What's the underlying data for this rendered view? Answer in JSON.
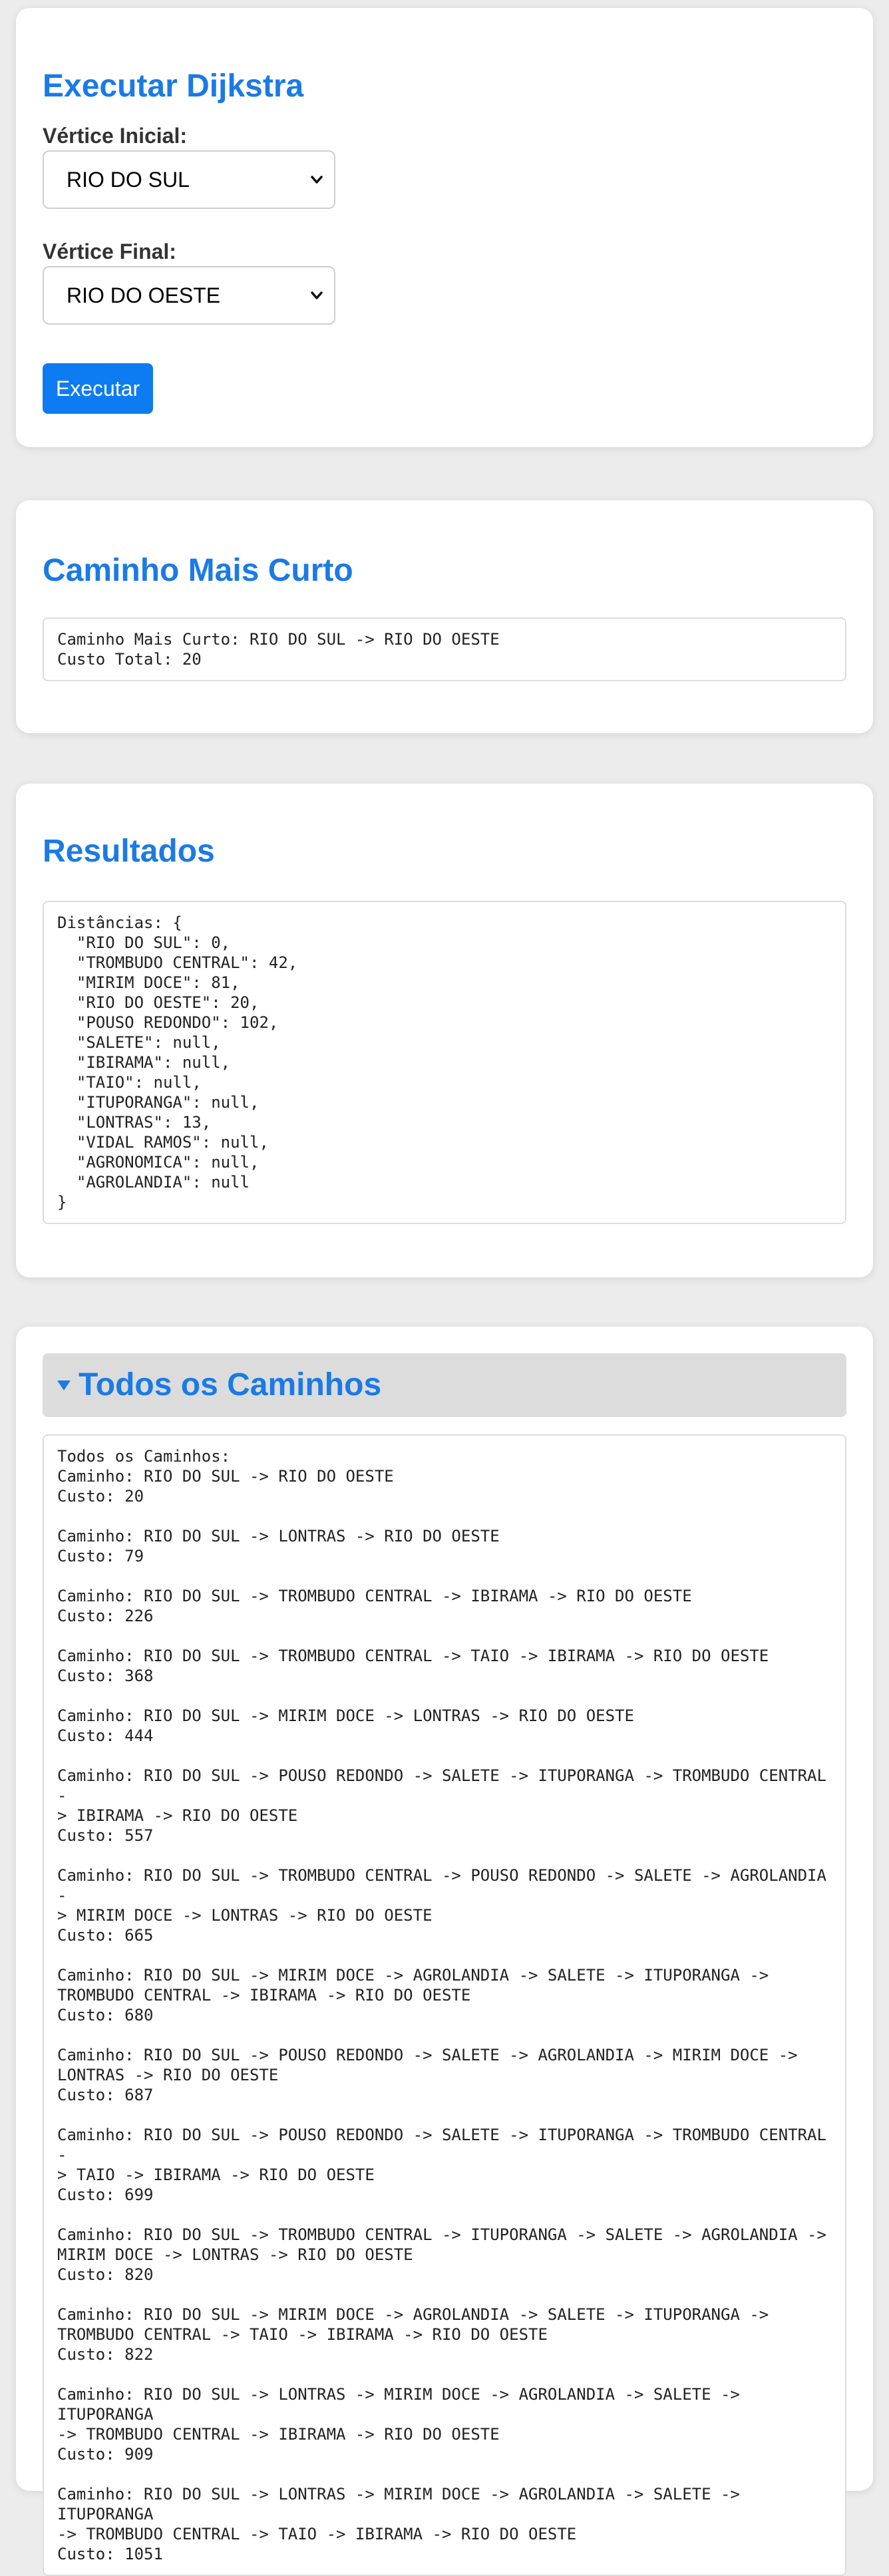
{
  "form": {
    "title": "Executar Dijkstra",
    "start_label": "Vértice Inicial:",
    "start_value": "RIO DO SUL",
    "end_label": "Vértice Final:",
    "end_value": "RIO DO OESTE",
    "button_label": "Executar"
  },
  "shortest": {
    "title": "Caminho Mais Curto",
    "text": "Caminho Mais Curto: RIO DO SUL -> RIO DO OESTE\nCusto Total: 20"
  },
  "results": {
    "title": "Resultados",
    "text": "Distâncias: {\n  \"RIO DO SUL\": 0,\n  \"TROMBUDO CENTRAL\": 42,\n  \"MIRIM DOCE\": 81,\n  \"RIO DO OESTE\": 20,\n  \"POUSO REDONDO\": 102,\n  \"SALETE\": null,\n  \"IBIRAMA\": null,\n  \"TAIO\": null,\n  \"ITUPORANGA\": null,\n  \"LONTRAS\": 13,\n  \"VIDAL RAMOS\": null,\n  \"AGRONOMICA\": null,\n  \"AGROLANDIA\": null\n}"
  },
  "all_paths": {
    "title": "Todos os Caminhos",
    "toggle_icon": "triangle-down",
    "text": "Todos os Caminhos:\nCaminho: RIO DO SUL -> RIO DO OESTE\nCusto: 20\n\nCaminho: RIO DO SUL -> LONTRAS -> RIO DO OESTE\nCusto: 79\n\nCaminho: RIO DO SUL -> TROMBUDO CENTRAL -> IBIRAMA -> RIO DO OESTE\nCusto: 226\n\nCaminho: RIO DO SUL -> TROMBUDO CENTRAL -> TAIO -> IBIRAMA -> RIO DO OESTE\nCusto: 368\n\nCaminho: RIO DO SUL -> MIRIM DOCE -> LONTRAS -> RIO DO OESTE\nCusto: 444\n\nCaminho: RIO DO SUL -> POUSO REDONDO -> SALETE -> ITUPORANGA -> TROMBUDO CENTRAL -\n> IBIRAMA -> RIO DO OESTE\nCusto: 557\n\nCaminho: RIO DO SUL -> TROMBUDO CENTRAL -> POUSO REDONDO -> SALETE -> AGROLANDIA -\n> MIRIM DOCE -> LONTRAS -> RIO DO OESTE\nCusto: 665\n\nCaminho: RIO DO SUL -> MIRIM DOCE -> AGROLANDIA -> SALETE -> ITUPORANGA ->\nTROMBUDO CENTRAL -> IBIRAMA -> RIO DO OESTE\nCusto: 680\n\nCaminho: RIO DO SUL -> POUSO REDONDO -> SALETE -> AGROLANDIA -> MIRIM DOCE ->\nLONTRAS -> RIO DO OESTE\nCusto: 687\n\nCaminho: RIO DO SUL -> POUSO REDONDO -> SALETE -> ITUPORANGA -> TROMBUDO CENTRAL -\n> TAIO -> IBIRAMA -> RIO DO OESTE\nCusto: 699\n\nCaminho: RIO DO SUL -> TROMBUDO CENTRAL -> ITUPORANGA -> SALETE -> AGROLANDIA ->\nMIRIM DOCE -> LONTRAS -> RIO DO OESTE\nCusto: 820\n\nCaminho: RIO DO SUL -> MIRIM DOCE -> AGROLANDIA -> SALETE -> ITUPORANGA ->\nTROMBUDO CENTRAL -> TAIO -> IBIRAMA -> RIO DO OESTE\nCusto: 822\n\nCaminho: RIO DO SUL -> LONTRAS -> MIRIM DOCE -> AGROLANDIA -> SALETE -> ITUPORANGA\n-> TROMBUDO CENTRAL -> IBIRAMA -> RIO DO OESTE\nCusto: 909\n\nCaminho: RIO DO SUL -> LONTRAS -> MIRIM DOCE -> AGROLANDIA -> SALETE -> ITUPORANGA\n-> TROMBUDO CENTRAL -> TAIO -> IBIRAMA -> RIO DO OESTE\nCusto: 1051"
  }
}
